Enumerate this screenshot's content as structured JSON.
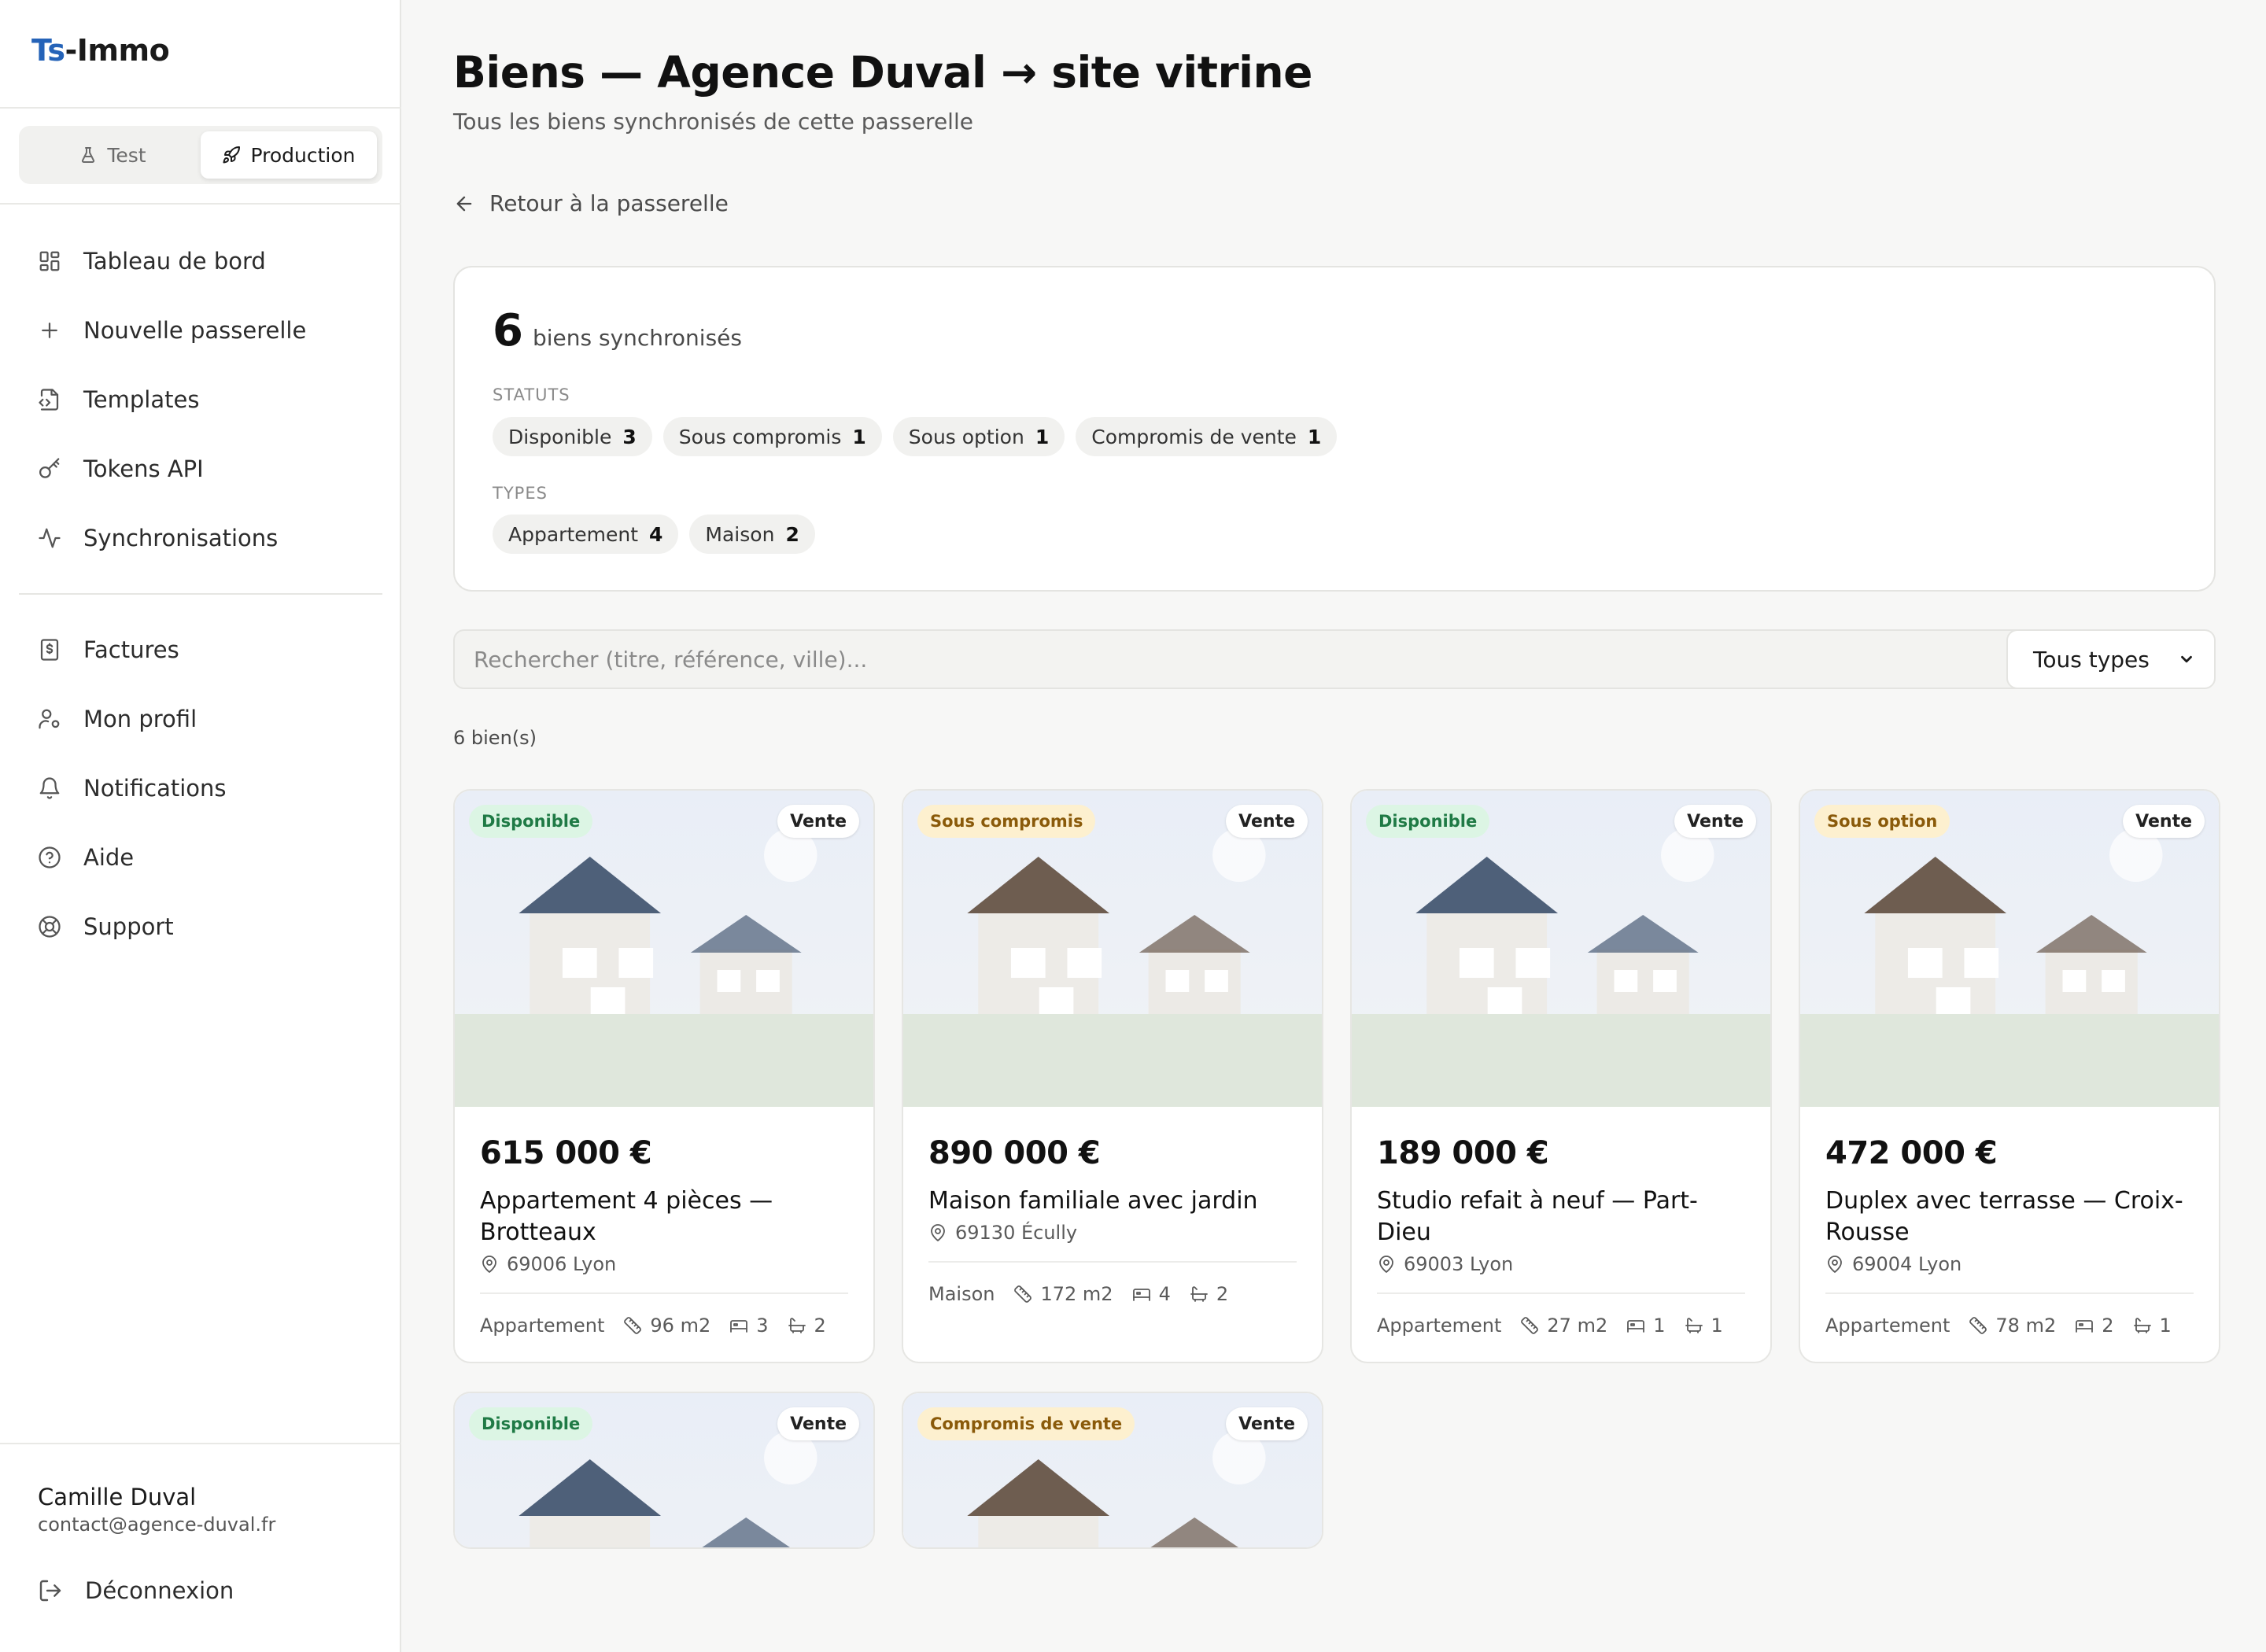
{
  "brand": {
    "part1": "Ts",
    "part2": "-Immo"
  },
  "env": {
    "test": "Test",
    "production": "Production"
  },
  "nav_main": [
    {
      "id": "dashboard",
      "label": "Tableau de bord"
    },
    {
      "id": "new-gateway",
      "label": "Nouvelle passerelle"
    },
    {
      "id": "templates",
      "label": "Templates"
    },
    {
      "id": "tokens",
      "label": "Tokens API"
    },
    {
      "id": "syncs",
      "label": "Synchronisations"
    }
  ],
  "nav_secondary": [
    {
      "id": "invoices",
      "label": "Factures"
    },
    {
      "id": "profile",
      "label": "Mon profil"
    },
    {
      "id": "notifications",
      "label": "Notifications"
    },
    {
      "id": "help",
      "label": "Aide"
    },
    {
      "id": "support",
      "label": "Support"
    }
  ],
  "user": {
    "name": "Camille Duval",
    "email": "contact@agence-duval.fr",
    "logout": "Déconnexion"
  },
  "page": {
    "title": "Biens — Agence Duval → site vitrine",
    "subtitle": "Tous les biens synchronisés de cette passerelle",
    "back": "Retour à la passerelle"
  },
  "stats": {
    "count": "6",
    "count_label": "biens synchronisés",
    "statuts_label": "STATUTS",
    "statuts": [
      {
        "label": "Disponible",
        "count": "3"
      },
      {
        "label": "Sous compromis",
        "count": "1"
      },
      {
        "label": "Sous option",
        "count": "1"
      },
      {
        "label": "Compromis de vente",
        "count": "1"
      }
    ],
    "types_label": "TYPES",
    "types": [
      {
        "label": "Appartement",
        "count": "4"
      },
      {
        "label": "Maison",
        "count": "2"
      }
    ]
  },
  "search": {
    "placeholder": "Rechercher (titre, référence, ville)..."
  },
  "type_filter": {
    "selected": "Tous types"
  },
  "results_count": "6 bien(s)",
  "colors": {
    "disponible_bg": "#dcf5e4",
    "disponible_fg": "#1f7a45",
    "warn_bg": "#fdf0cf",
    "warn_fg": "#8a5a0a",
    "roof_blue": "#4e6079",
    "roof_brown": "#6e5d50"
  },
  "properties": [
    {
      "status": "Disponible",
      "tone": "ok",
      "transaction": "Vente",
      "price": "615 000 €",
      "title": "Appartement 4 pièces — Brotteaux",
      "location": "69006 Lyon",
      "type": "Appartement",
      "surface": "96 m2",
      "rooms": "3",
      "baths": "2",
      "roof": "blue"
    },
    {
      "status": "Sous compromis",
      "tone": "warn",
      "transaction": "Vente",
      "price": "890 000 €",
      "title": "Maison familiale avec jardin",
      "location": "69130 Écully",
      "type": "Maison",
      "surface": "172 m2",
      "rooms": "4",
      "baths": "2",
      "roof": "brown"
    },
    {
      "status": "Disponible",
      "tone": "ok",
      "transaction": "Vente",
      "price": "189 000 €",
      "title": "Studio refait à neuf — Part-Dieu",
      "location": "69003 Lyon",
      "type": "Appartement",
      "surface": "27 m2",
      "rooms": "1",
      "baths": "1",
      "roof": "blue"
    },
    {
      "status": "Sous option",
      "tone": "warn",
      "transaction": "Vente",
      "price": "472 000 €",
      "title": "Duplex avec terrasse — Croix-Rousse",
      "location": "69004 Lyon",
      "type": "Appartement",
      "surface": "78 m2",
      "rooms": "2",
      "baths": "1",
      "roof": "brown"
    },
    {
      "status": "Disponible",
      "tone": "ok",
      "transaction": "Vente",
      "roof": "blue"
    },
    {
      "status": "Compromis de vente",
      "tone": "warn",
      "transaction": "Vente",
      "roof": "brown"
    }
  ]
}
